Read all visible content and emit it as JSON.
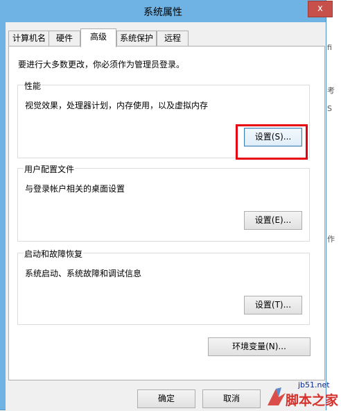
{
  "window": {
    "title": "系统属性",
    "close_glyph": "x"
  },
  "tabs": [
    {
      "label": "计算机名",
      "active": false
    },
    {
      "label": "硬件",
      "active": false
    },
    {
      "label": "高级",
      "active": true
    },
    {
      "label": "系统保护",
      "active": false
    },
    {
      "label": "远程",
      "active": false
    }
  ],
  "advanced": {
    "intro": "要进行大多数更改，你必须作为管理员登录。",
    "performance": {
      "title": "性能",
      "description": "视觉效果，处理器计划，内存使用，以及虚拟内存",
      "button": "设置(S)..."
    },
    "user_profiles": {
      "title": "用户配置文件",
      "description": "与登录帐户相关的桌面设置",
      "button": "设置(E)..."
    },
    "startup_recovery": {
      "title": "启动和故障恢复",
      "description": "系统启动、系统故障和调试信息",
      "button": "设置(T)..."
    },
    "env_button": "环境变量(N)..."
  },
  "footer": {
    "ok": "确定",
    "cancel": "取消"
  },
  "background_fragments": [
    "fi",
    "考",
    "S",
    "作"
  ],
  "watermark": {
    "url": "jb51.net",
    "name": "脚本之家"
  },
  "colors": {
    "highlight": "#e60012",
    "frame": "#6fb3e4",
    "close": "#c7504a"
  }
}
